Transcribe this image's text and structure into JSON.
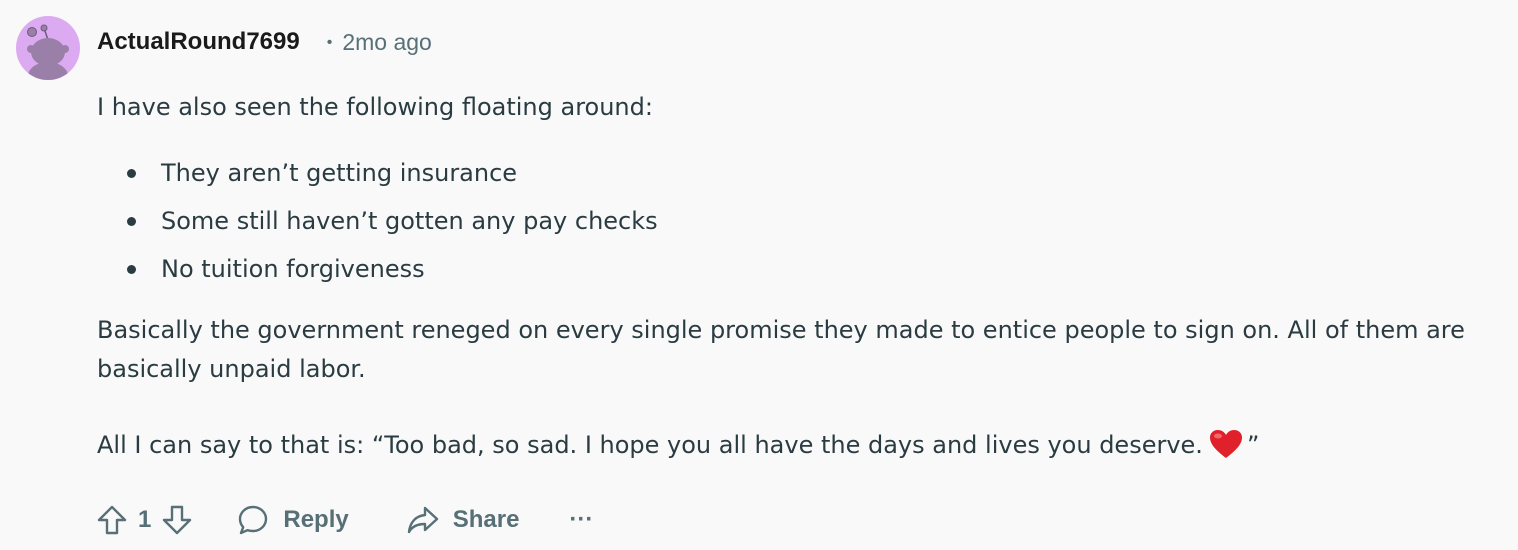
{
  "comment": {
    "username": "ActualRound7699",
    "separator": "•",
    "time_ago": "2mo ago",
    "intro": "I have also seen the following floating around:",
    "bullets": [
      "They aren’t getting insurance",
      "Some still haven’t gotten any pay checks",
      "No tuition forgiveness"
    ],
    "paragraph2": "Basically the government reneged on every single promise they made to entice people to sign on. All of them are basically unpaid labor.",
    "paragraph3_before": "All I can say to that is: “Too bad, so sad. I hope you all have the days and lives you deserve.",
    "paragraph3_after": "”"
  },
  "actions": {
    "score": "1",
    "reply_label": "Reply",
    "share_label": "Share",
    "more_label": "···"
  },
  "icons": {
    "avatar": "reddit-snoo-avatar-icon",
    "upvote": "arrow-up-icon",
    "downvote": "arrow-down-icon",
    "reply": "speech-bubble-icon",
    "share": "share-arrow-icon",
    "heart": "red-heart-emoji-icon"
  },
  "colors": {
    "background": "#f9f9f9",
    "avatar_bg": "#dcaaf0",
    "text": "#2a3c42",
    "muted": "#576f76",
    "heart": "#e0202a"
  }
}
